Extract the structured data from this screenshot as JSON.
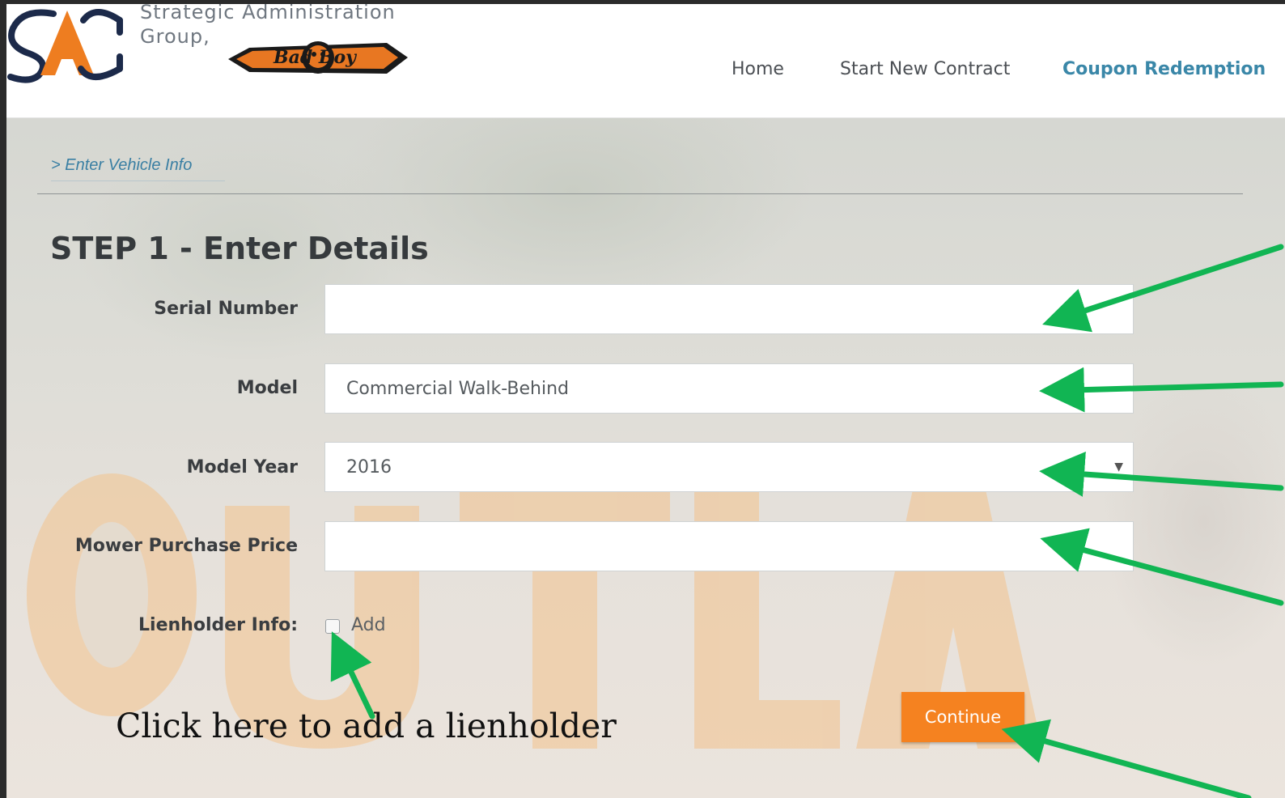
{
  "header": {
    "company_line1": "Strategic Administration",
    "company_line2": "Group,",
    "logo_icon": "sag-logo-icon",
    "brand_badge_icon": "bad-boy-mowers-logo-icon",
    "brand_badge_text": "Bad Boy"
  },
  "nav": {
    "items": [
      {
        "label": "Home"
      },
      {
        "label": "Start New Contract"
      },
      {
        "label": "Coupon Redemption",
        "active": true
      }
    ]
  },
  "breadcrumb": "> Enter Vehicle Info",
  "step_title": "STEP 1 - Enter Details",
  "form": {
    "serial_number": {
      "label": "Serial Number",
      "value": ""
    },
    "model": {
      "label": "Model",
      "value": "Commercial Walk-Behind"
    },
    "model_year": {
      "label": "Model Year",
      "value": "2016"
    },
    "purchase_price": {
      "label": "Mower Purchase Price",
      "value": ""
    },
    "lienholder": {
      "label": "Lienholder Info:",
      "option_label": "Add",
      "checked": false
    }
  },
  "continue_label": "Continue",
  "callout_text": "Click here to add a lienholder",
  "colors": {
    "accent_orange": "#f58220",
    "nav_active": "#3a87a8",
    "arrow_green": "#11b553"
  }
}
